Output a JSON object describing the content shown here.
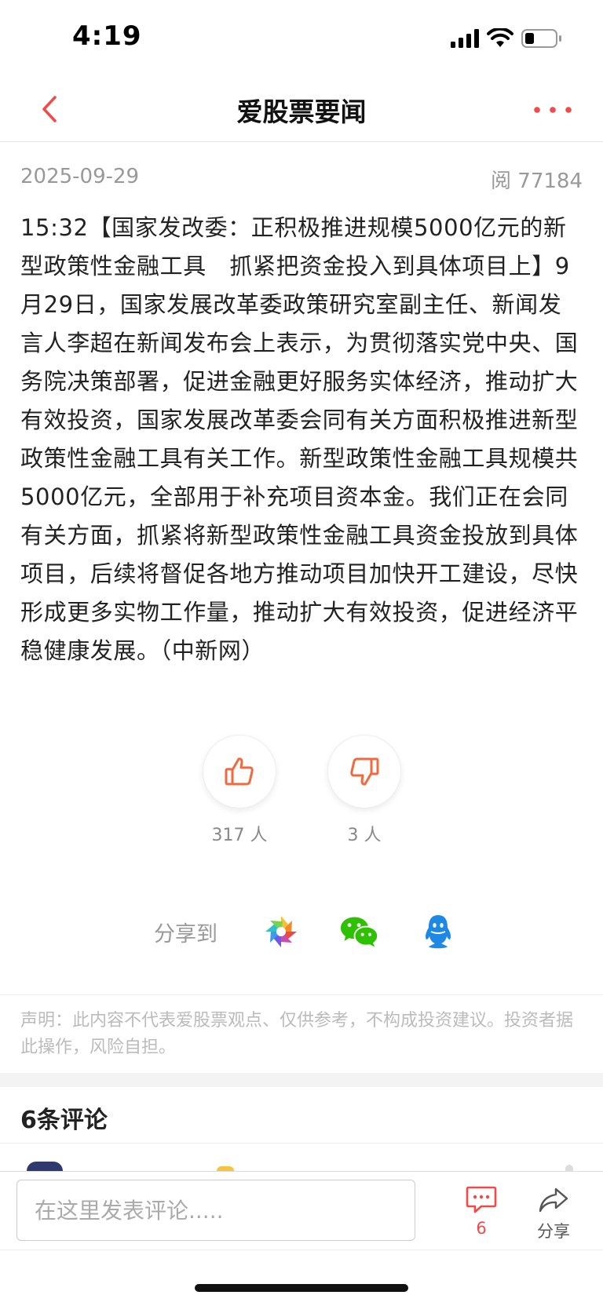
{
  "status_bar": {
    "time": "4:19"
  },
  "nav": {
    "title": "爱股票要闻"
  },
  "article": {
    "date": "2025-09-29",
    "reads": "阅 77184",
    "body": "15:32【国家发改委：正积极推进规模5000亿元的新型政策性金融工具　抓紧把资金投入到具体项目上】9月29日，国家发展改革委政策研究室副主任、新闻发言人李超在新闻发布会上表示，为贯彻落实党中央、国务院决策部署，促进金融更好服务实体经济，推动扩大有效投资，国家发展改革委会同有关方面积极推进新型政策性金融工具有关工作。新型政策性金融工具规模共5000亿元，全部用于补充项目资本金。我们正在会同有关方面，抓紧将新型政策性金融工具资金投放到具体项目，后续将督促各地方推动项目加快开工建设，尽快形成更多实物工作量，推动扩大有效投资，促进经济平稳健康发展。（中新网）"
  },
  "votes": {
    "like_count": "317 人",
    "dislike_count": "3 人"
  },
  "share": {
    "label": "分享到",
    "targets": [
      "moments-icon",
      "wechat-icon",
      "qq-icon"
    ]
  },
  "disclaimer": "声明：此内容不代表爱股票观点、仅供参考，不构成投资建议。投资者据此操作，风险自担。",
  "comments": {
    "header": "6条评论"
  },
  "bottom_bar": {
    "input_placeholder": "在这里发表评论.....",
    "comment_count": "6",
    "share_label": "分享"
  },
  "colors": {
    "accent": "#f04a4a",
    "like_icon": "#f06a3f",
    "wechat": "#2dc100",
    "qq": "#1e88e5"
  }
}
